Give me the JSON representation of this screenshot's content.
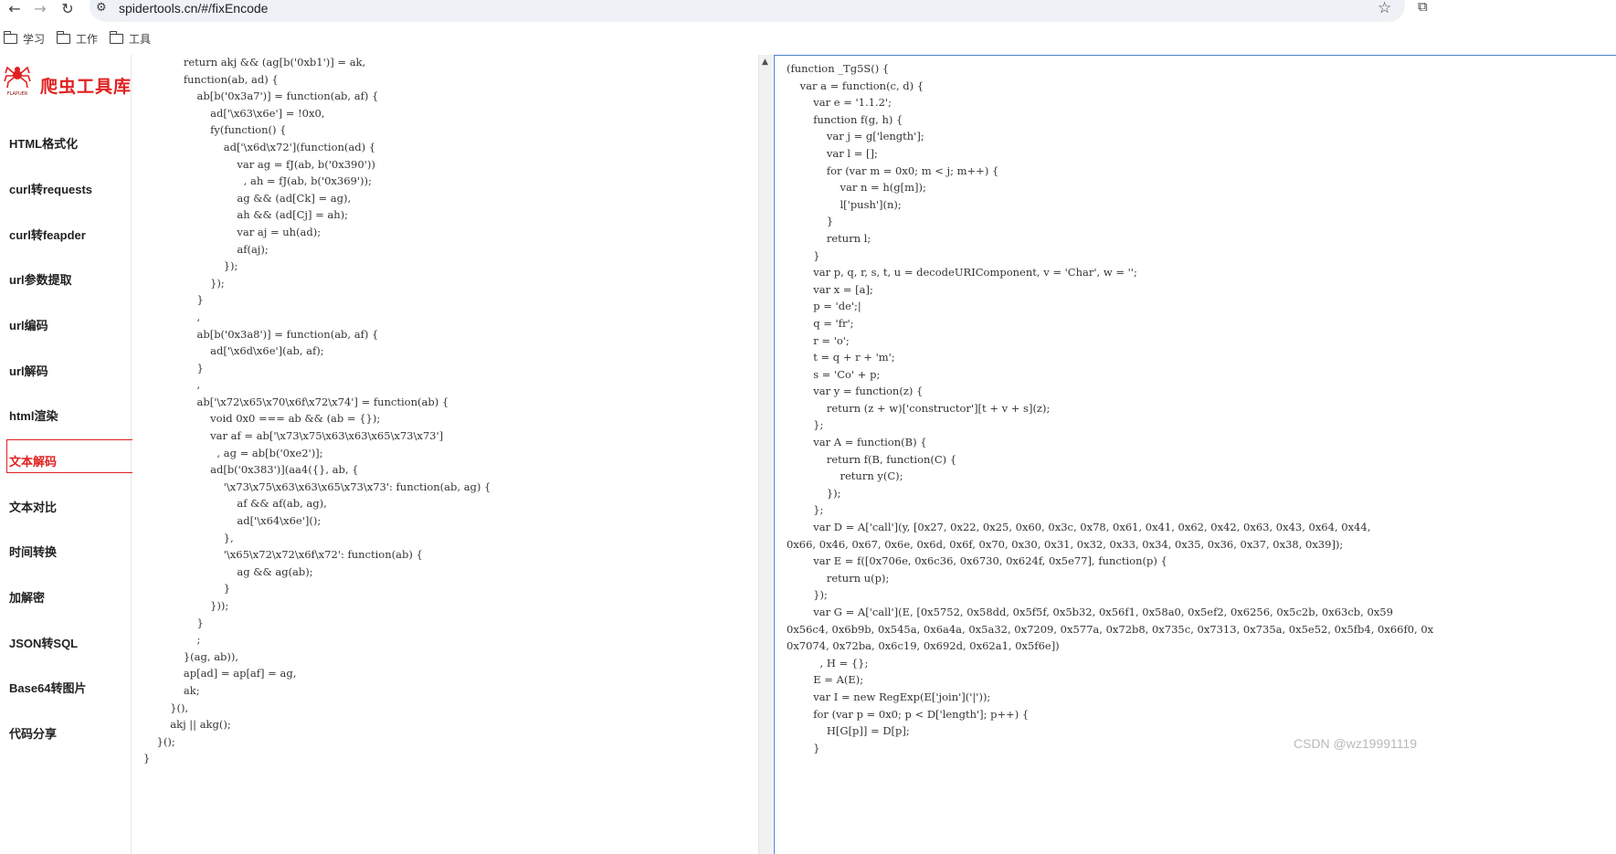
{
  "browser": {
    "url": "spidertools.cn/#/fixEncode",
    "icons": {
      "back": "arrow-left-icon",
      "forward": "arrow-right-icon",
      "reload": "reload-icon",
      "site_info": "tune-icon",
      "bookmark_star": "star-icon",
      "extensions": "extension-icon"
    }
  },
  "bookmarks": [
    {
      "label": "学习",
      "icon": "folder-icon"
    },
    {
      "label": "工作",
      "icon": "folder-icon"
    },
    {
      "label": "工具",
      "icon": "folder-icon"
    }
  ],
  "sidebar": {
    "logo_text": "爬虫工具库",
    "logo_mark_text": "FLAPUER",
    "accent_color": "#e02020",
    "items": [
      {
        "label": "HTML格式化"
      },
      {
        "label": "curl转requests"
      },
      {
        "label": "curl转feapder"
      },
      {
        "label": "url参数提取"
      },
      {
        "label": "url编码"
      },
      {
        "label": "url解码"
      },
      {
        "label": "html渲染"
      },
      {
        "label": "文本解码",
        "active": true
      },
      {
        "label": "文本对比"
      },
      {
        "label": "时间转换"
      },
      {
        "label": "加解密"
      },
      {
        "label": "JSON转SQL"
      },
      {
        "label": "Base64转图片"
      },
      {
        "label": "代码分享"
      }
    ]
  },
  "left_editor": {
    "lines": [
      "            return akj && (ag[b('0xb1')] = ak,",
      "            function(ab, ad) {",
      "                ab[b('0x3a7')] = function(ab, af) {",
      "                    ad['\\x63\\x6e'] = !0x0,",
      "                    fy(function() {",
      "                        ad['\\x6d\\x72'](function(ad) {",
      "                            var ag = fJ(ab, b('0x390'))",
      "                              , ah = fJ(ab, b('0x369'));",
      "                            ag && (ad[Ck] = ag),",
      "                            ah && (ad[Cj] = ah);",
      "                            var aj = uh(ad);",
      "                            af(aj);",
      "                        });",
      "                    });",
      "                }",
      "                ,",
      "                ab[b('0x3a8')] = function(ab, af) {",
      "                    ad['\\x6d\\x6e'](ab, af);",
      "                }",
      "                ,",
      "                ab['\\x72\\x65\\x70\\x6f\\x72\\x74'] = function(ab) {",
      "                    void 0x0 === ab && (ab = {});",
      "                    var af = ab['\\x73\\x75\\x63\\x63\\x65\\x73\\x73']",
      "                      , ag = ab[b('0xe2')];",
      "                    ad[b('0x383')](aa4({}, ab, {",
      "                        '\\x73\\x75\\x63\\x63\\x65\\x73\\x73': function(ab, ag) {",
      "                            af && af(ab, ag),",
      "                            ad['\\x64\\x6e']();",
      "                        },",
      "                        '\\x65\\x72\\x72\\x6f\\x72': function(ab) {",
      "                            ag && ag(ab);",
      "                        }",
      "                    }));",
      "                }",
      "                ;",
      "            }(ag, ab)),",
      "            ap[ad] = ap[af] = ag,",
      "            ak;",
      "        }(),",
      "        akj || akg();",
      "    }();",
      "}"
    ]
  },
  "right_editor": {
    "lines": [
      "(function _Tg5S() {",
      "    var a = function(c, d) {",
      "        var e = '1.1.2';",
      "        function f(g, h) {",
      "            var j = g['length'];",
      "            var l = [];",
      "            for (var m = 0x0; m < j; m++) {",
      "                var n = h(g[m]);",
      "                l['push'](n);",
      "            }",
      "            return l;",
      "        }",
      "        var p, q, r, s, t, u = decodeURIComponent, v = 'Char', w = '';",
      "        var x = [a];",
      "        p = 'de';|",
      "        q = 'fr';",
      "        r = 'o';",
      "        t = q + r + 'm';",
      "        s = 'Co' + p;",
      "        var y = function(z) {",
      "            return (z + w)['constructor'][t + v + s](z);",
      "        };",
      "        var A = function(B) {",
      "            return f(B, function(C) {",
      "                return y(C);",
      "            });",
      "        };",
      "        var D = A['call'](y, [0x27, 0x22, 0x25, 0x60, 0x3c, 0x78, 0x61, 0x41, 0x62, 0x42, 0x63, 0x43, 0x64, 0x44,",
      "0x66, 0x46, 0x67, 0x6e, 0x6d, 0x6f, 0x70, 0x30, 0x31, 0x32, 0x33, 0x34, 0x35, 0x36, 0x37, 0x38, 0x39]);",
      "        var E = f([0x706e, 0x6c36, 0x6730, 0x624f, 0x5e77], function(p) {",
      "            return u(p);",
      "        });",
      "        var G = A['call'](E, [0x5752, 0x58dd, 0x5f5f, 0x5b32, 0x56f1, 0x58a0, 0x5ef2, 0x6256, 0x5c2b, 0x63cb, 0x59",
      "0x56c4, 0x6b9b, 0x545a, 0x6a4a, 0x5a32, 0x7209, 0x577a, 0x72b8, 0x735c, 0x7313, 0x735a, 0x5e52, 0x5fb4, 0x66f0, 0x",
      "0x7074, 0x72ba, 0x6c19, 0x692d, 0x62a1, 0x5f6e])",
      "          , H = {};",
      "        E = A(E);",
      "        var I = new RegExp(E['join']('|'));",
      "        for (var p = 0x0; p < D['length']; p++) {",
      "            H[G[p]] = D[p];",
      "        }"
    ]
  },
  "watermark": "CSDN @wz19991119"
}
